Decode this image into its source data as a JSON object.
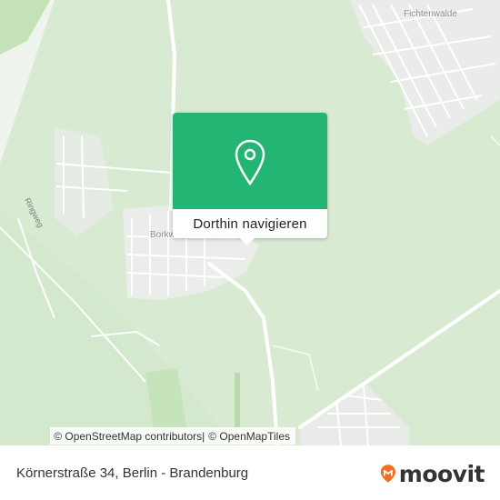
{
  "map": {
    "places": {
      "fichtenwalde": "Fichtenwalde",
      "borkwalde": "Borkwalde"
    },
    "roads": {
      "ringweg": "Ringweg"
    }
  },
  "popup": {
    "button_label": "Dorthin navigieren",
    "pin_color": "#22b573"
  },
  "attribution": {
    "osm_contributors": "© OpenStreetMap contributors",
    "openmaptiles": "© OpenMapTiles"
  },
  "footer": {
    "address": "Körnerstraße 34, Berlin - Brandenburg",
    "logo_text": "moovit",
    "logo_color": "#f26f21"
  }
}
